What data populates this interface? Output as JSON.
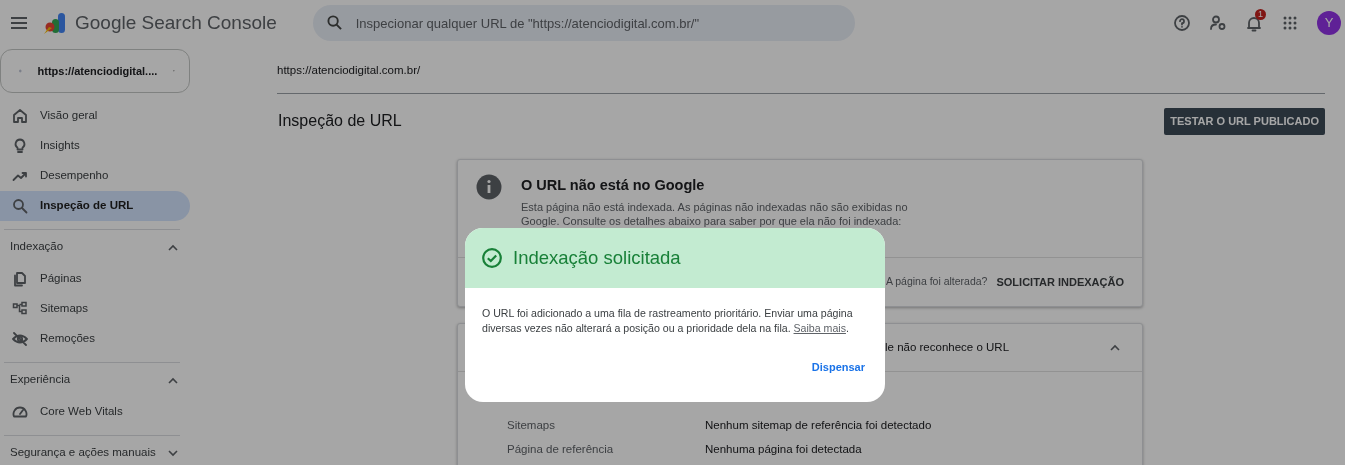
{
  "header": {
    "title": "Google Search Console",
    "search_placeholder": "Inspecionar qualquer URL de \"https://atenciodigital.com.br/\"",
    "notification_count": "1",
    "avatar": "Y"
  },
  "sidebar": {
    "property": "https://atenciodigital....",
    "items": [
      {
        "label": "Visão geral",
        "selected": false
      },
      {
        "label": "Insights",
        "selected": false
      },
      {
        "label": "Desempenho",
        "selected": false
      },
      {
        "label": "Inspeção de URL",
        "selected": true
      }
    ],
    "sections": [
      {
        "title": "Indexação",
        "expanded": true,
        "items": [
          {
            "label": "Páginas",
            "selected": false
          },
          {
            "label": "Sitemaps",
            "selected": false
          },
          {
            "label": "Remoções",
            "selected": false
          }
        ]
      },
      {
        "title": "Experiência",
        "expanded": true,
        "items": [
          {
            "label": "Core Web Vitals",
            "selected": false
          }
        ]
      },
      {
        "title": "Segurança e ações manuais",
        "expanded": false
      }
    ]
  },
  "main": {
    "breadcrumb": "https://atenciodigital.com.br/",
    "title": "Inspeção de URL",
    "test_button": "TESTAR O URL PUBLICADO",
    "status_card": {
      "heading": "O URL não está no Google",
      "description": "Esta página não está indexada. As páginas não indexadas não são exibidas no Google. Consulte os detalhes abaixo para saber por que ela não foi indexada:",
      "question": "A página foi alterada?",
      "action": "SOLICITAR INDEXAÇÃO"
    },
    "details_card": {
      "title": "le não reconhece o URL",
      "expanded": true,
      "rows": [
        {
          "label": "Sitemaps",
          "value": "Nenhum sitemap de referência foi detectado"
        },
        {
          "label": "Página de referência",
          "value": "Nenhuma página foi detectada"
        }
      ]
    }
  },
  "dialog": {
    "title": "Indexação solicitada",
    "body": "O URL foi adicionado a uma fila de rastreamento prioritário. Enviar uma página diversas vezes não alterará a posição ou a prioridade dela na fila. ",
    "link": "Saiba mais",
    "suffix": ".",
    "button": "Dispensar"
  }
}
